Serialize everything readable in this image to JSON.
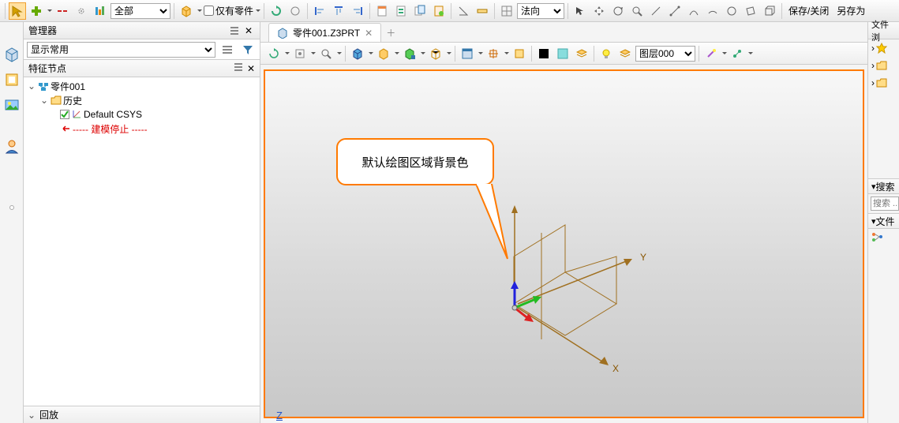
{
  "toolbar_top": {
    "filter1_options": [
      "全部"
    ],
    "only_parts_label": "仅有零件",
    "normal_select_options": [
      "法向"
    ],
    "save_close": "保存/关闭",
    "save_as": "另存为"
  },
  "manager": {
    "title": "管理器",
    "display_mode_options": [
      "显示常用"
    ],
    "feature_section": "特征节点",
    "tree": {
      "root": "零件001",
      "history": "历史",
      "default_csys": "Default CSYS",
      "model_stop": "----- 建模停止 -----"
    },
    "playback": "回放"
  },
  "tabs": {
    "active": "零件001.Z3PRT"
  },
  "view_toolbar": {
    "layer_select": "图层000"
  },
  "viewport": {
    "callout_text": "默认绘图区域背景色",
    "axis_x": "X",
    "axis_y": "Y",
    "axis_z_bottom": "Z"
  },
  "right_panel": {
    "title": "文件浏",
    "search_header": "搜索",
    "search_placeholder": "搜索 ...",
    "files_header": "文件"
  },
  "icons": {
    "cursor": "cursor",
    "plus": "plus",
    "dash": "dash",
    "circle": "circle",
    "bars": "bars",
    "cube": "cube",
    "checkbox": "checkbox",
    "chev_down": "chev",
    "filter": "filter",
    "lightbulb": "bulb"
  }
}
